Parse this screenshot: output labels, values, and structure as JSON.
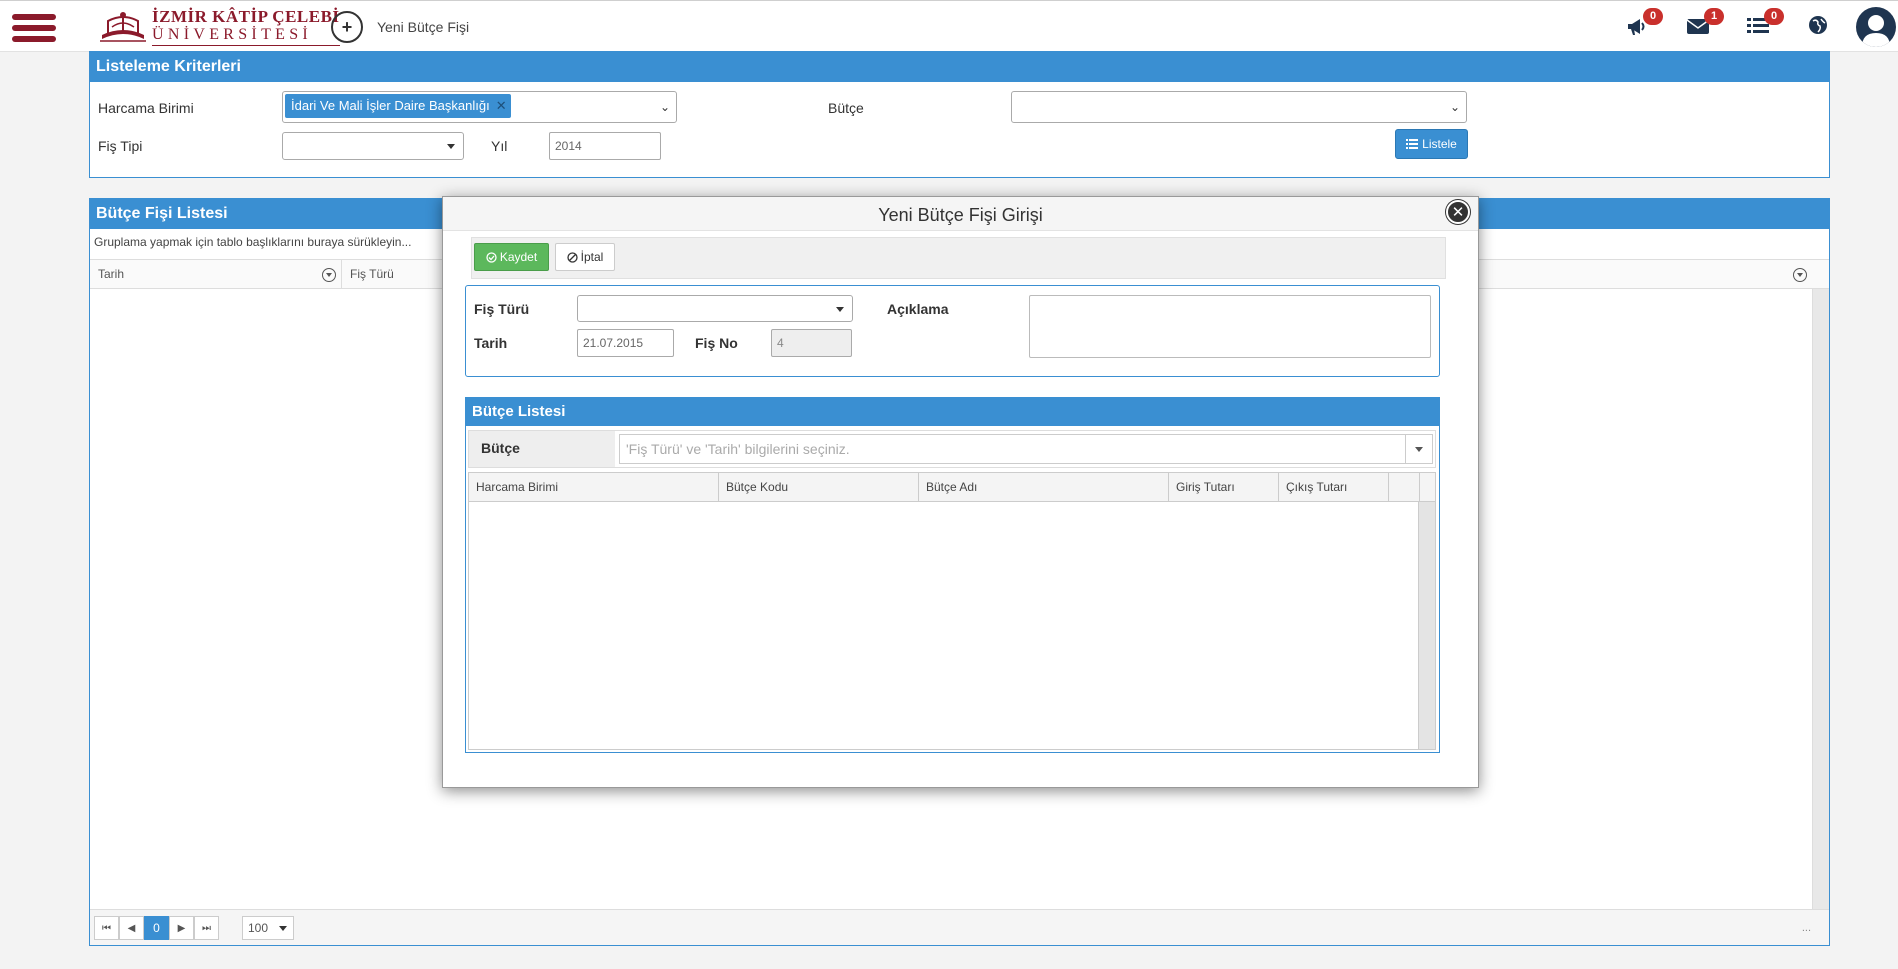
{
  "header": {
    "logo_line1": "İZMİR KÂTİP ÇELEBİ",
    "logo_line2": "ÜNİVERSİTESİ",
    "new_button_label": "Yeni Bütçe Fişi",
    "announcements_count": "0",
    "messages_count": "1",
    "tasks_count": "0"
  },
  "criteria": {
    "title": "Listeleme Kriterleri",
    "harcama_birimi_label": "Harcama Birimi",
    "harcama_birimi_tag": "İdari Ve Mali İşler Daire Başkanlığı",
    "butce_label": "Bütçe",
    "fis_tipi_label": "Fiş Tipi",
    "yil_label": "Yıl",
    "yil_value": "2014",
    "list_button": "Listele"
  },
  "main_grid": {
    "title": "Bütçe Fişi Listesi",
    "group_hint": "Gruplama yapmak için tablo başlıklarını buraya sürükleyin...",
    "columns": [
      "Tarih",
      "Fiş Türü"
    ],
    "pager": {
      "first": "⏮",
      "prev": "◀",
      "page": "0",
      "next": "▶",
      "last": "⏭",
      "page_size": "100",
      "info": "..."
    }
  },
  "modal": {
    "title": "Yeni Bütçe Fişi Girişi",
    "save_label": "Kaydet",
    "cancel_label": "İptal",
    "fis_turu_label": "Fiş Türü",
    "aciklama_label": "Açıklama",
    "tarih_label": "Tarih",
    "tarih_value": "21.07.2015",
    "fis_no_label": "Fiş No",
    "fis_no_value": "4",
    "list_title": "Bütçe Listesi",
    "budget_label": "Bütçe",
    "budget_placeholder": "'Fiş Türü' ve 'Tarih' bilgilerini seçiniz.",
    "columns": [
      "Harcama Birimi",
      "Bütçe Kodu",
      "Bütçe Adı",
      "Giriş Tutarı",
      "Çıkış Tutarı"
    ]
  },
  "colors": {
    "brand": "#8b1a2b",
    "panel_blue": "#3a8fd2",
    "save_green": "#5cb85c",
    "badge_red": "#c9302c"
  }
}
